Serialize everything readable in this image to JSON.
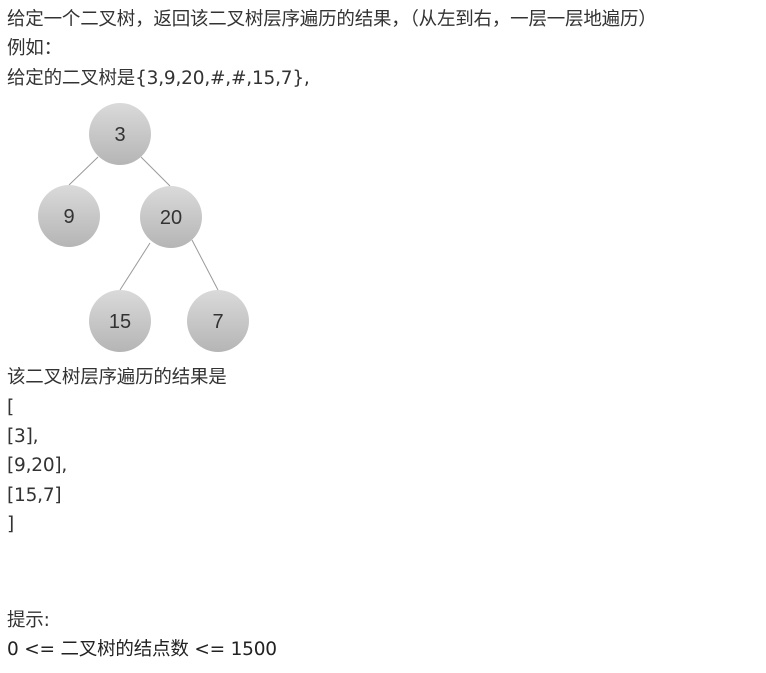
{
  "problem": {
    "description": "给定一个二叉树，返回该二叉树层序遍历的结果，（从左到右，一层一层地遍历）",
    "example_label": "例如：",
    "given_tree": "给定的二叉树是{3,9,20,#,#,15,7},"
  },
  "tree": {
    "nodes": {
      "root": "3",
      "left": "9",
      "right": "20",
      "right_left": "15",
      "right_right": "7"
    },
    "colors": {
      "node_fill_top": "#d9d9d9",
      "node_fill_bottom": "#b8b8b8",
      "edge": "#9a9a9a"
    }
  },
  "result": {
    "intro": "该二叉树层序遍历的结果是",
    "lines": [
      "[",
      "[3],",
      "[9,20],",
      "[15,7]",
      "]"
    ]
  },
  "hint": {
    "label": "提示:",
    "constraint": "0 <= 二叉树的结点数 <= 1500"
  }
}
